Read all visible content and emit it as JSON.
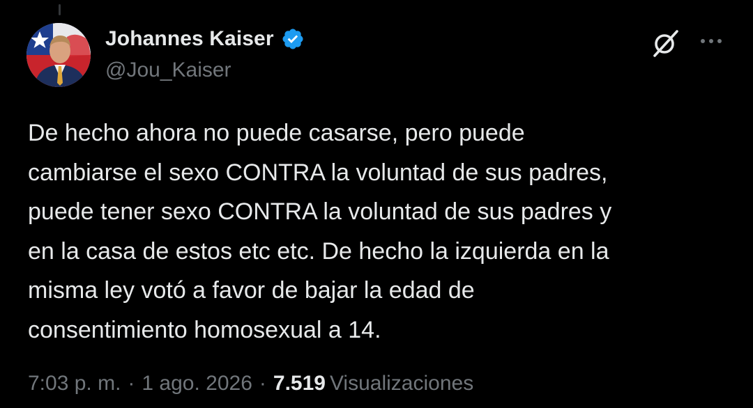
{
  "tweet": {
    "author": {
      "display_name": "Johannes Kaiser",
      "handle": "@Jou_Kaiser",
      "verified": true
    },
    "text": "De hecho ahora no puede casarse, pero puede\ncambiarse el sexo CONTRA la voluntad de sus padres,\npuede tener sexo CONTRA la voluntad de sus padres y\nen la casa de estos etc etc. De hecho la izquierda en la\nmisma ley votó a favor de bajar la edad de\nconsentimiento homosexual a 14.",
    "time": "7:03 p. m.",
    "separator": "·",
    "date": "1 ago. 2026",
    "views_count": "7.519",
    "views_label": "Visualizaciones"
  },
  "icons": {
    "verified": "verified-badge-icon",
    "grok": "grok-icon",
    "more": "more-options-icon"
  },
  "colors": {
    "background": "#000000",
    "text_primary": "#e7e9ea",
    "text_secondary": "#71767b",
    "verified_blue": "#1d9bf0"
  }
}
